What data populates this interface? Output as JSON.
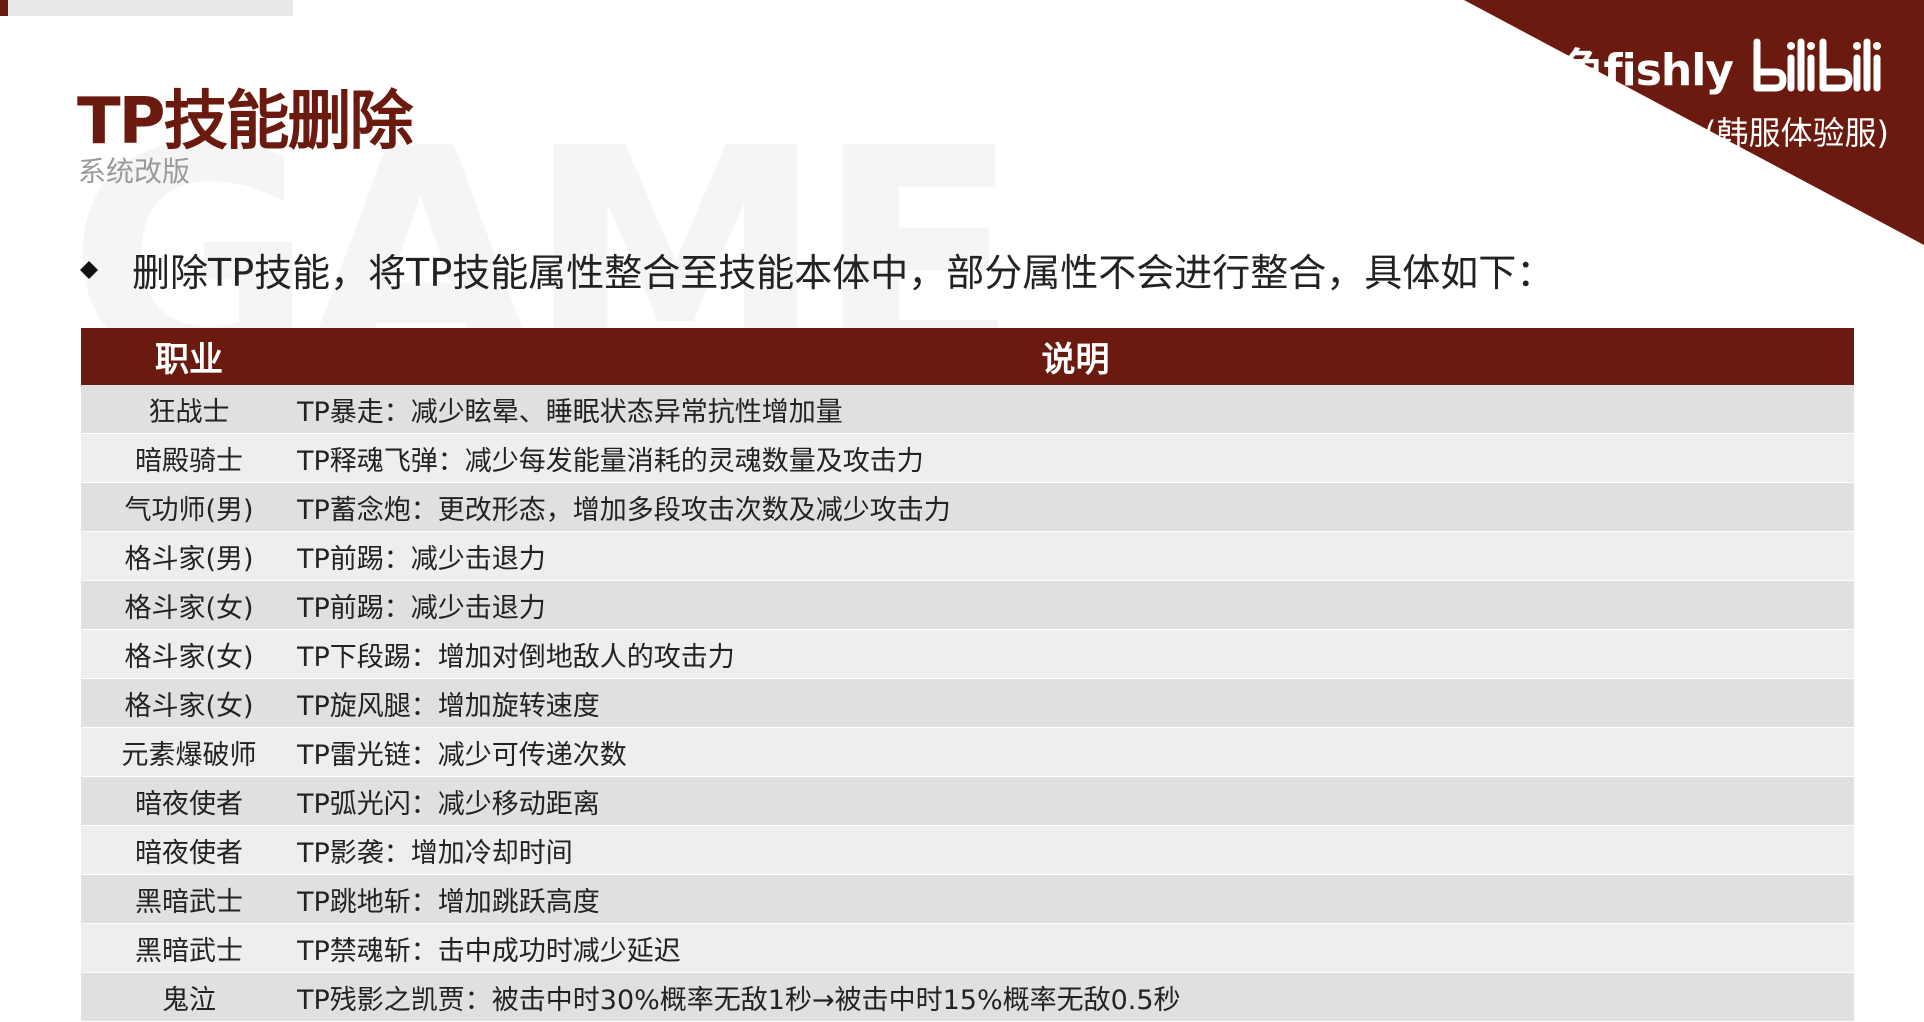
{
  "header": {
    "title": "TP技能删除",
    "subtitle": "系统改版",
    "watermark": "GAME"
  },
  "brand": {
    "name": "八爪鱼fishly",
    "logo_icon": "bilibili-logo-icon",
    "server": "(韩服体验服)"
  },
  "intro": {
    "bullet_icon": "diamond-bullet-icon",
    "text": "删除TP技能，将TP技能属性整合至技能本体中，部分属性不会进行整合，具体如下："
  },
  "table": {
    "columns": [
      "职业",
      "说明"
    ],
    "rows": [
      {
        "job": "狂战士",
        "desc": "TP暴走：减少眩晕、睡眠状态异常抗性增加量"
      },
      {
        "job": "暗殿骑士",
        "desc": "TP释魂飞弹：减少每发能量消耗的灵魂数量及攻击力"
      },
      {
        "job": "气功师(男)",
        "desc": "TP蓄念炮：更改形态，增加多段攻击次数及减少攻击力"
      },
      {
        "job": "格斗家(男)",
        "desc": "TP前踢：减少击退力"
      },
      {
        "job": "格斗家(女)",
        "desc": "TP前踢：减少击退力"
      },
      {
        "job": "格斗家(女)",
        "desc": "TP下段踢：增加对倒地敌人的攻击力"
      },
      {
        "job": "格斗家(女)",
        "desc": "TP旋风腿：增加旋转速度"
      },
      {
        "job": "元素爆破师",
        "desc": "TP雷光链：减少可传递次数"
      },
      {
        "job": "暗夜使者",
        "desc": "TP弧光闪：减少移动距离"
      },
      {
        "job": "暗夜使者",
        "desc": "TP影袭：增加冷却时间"
      },
      {
        "job": "黑暗武士",
        "desc": "TP跳地斩：增加跳跃高度"
      },
      {
        "job": "黑暗武士",
        "desc": "TP禁魂斩：击中成功时减少延迟"
      },
      {
        "job": "鬼泣",
        "desc": "TP残影之凯贾：被击中时30%概率无敌1秒→被击中时15%概率无敌0.5秒"
      }
    ]
  },
  "colors": {
    "accent": "#6b1a0f",
    "row_dark": "#e0e0e0",
    "row_light": "#eeeeee",
    "subtitle": "#9a9a9a"
  }
}
